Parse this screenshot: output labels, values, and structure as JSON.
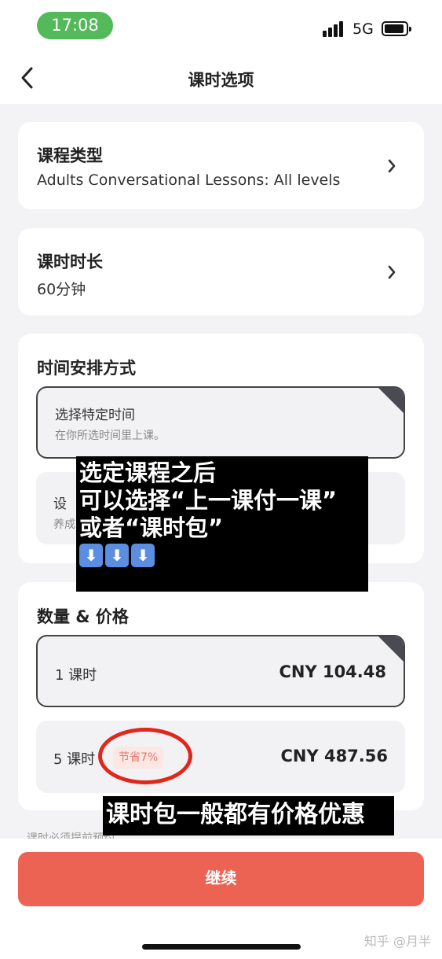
{
  "status_bar": {
    "time": "17:08",
    "network": "5G",
    "icons": [
      "signal-icon",
      "battery-icon"
    ]
  },
  "nav": {
    "title": "课时选项",
    "back_icon": "chevron-left-icon"
  },
  "lesson_type": {
    "title": "课程类型",
    "value": "Adults Conversational Lessons: All levels"
  },
  "duration": {
    "title": "课时时长",
    "value": "60分钟"
  },
  "schedule": {
    "title": "时间安排方式",
    "options": [
      {
        "title": "选择特定时间",
        "subtitle": "在你所选时间里上课。",
        "selected": true
      },
      {
        "title": "设",
        "subtitle": "养成",
        "selected": false
      }
    ]
  },
  "quantity_price": {
    "title": "数量 & 价格",
    "options": [
      {
        "qty": "1 课时",
        "price": "CNY 104.48",
        "selected": true,
        "badge": ""
      },
      {
        "qty": "5 课时",
        "price": "CNY 487.56",
        "selected": false,
        "badge": "节省7%"
      }
    ]
  },
  "note_partial": "课时必须提前预约",
  "continue_label": "继续",
  "overlay": {
    "lines": [
      "选定课程之后",
      "可以选择“上一课付一课”",
      "或者“课时包”"
    ],
    "caption": "课时包一般都有价格优惠"
  },
  "watermark": "知乎 @月半",
  "colors": {
    "accent": "#ec6353",
    "status_green": "#54b95a",
    "badge_text": "#e8756a",
    "annotation_red": "#e0271b"
  }
}
